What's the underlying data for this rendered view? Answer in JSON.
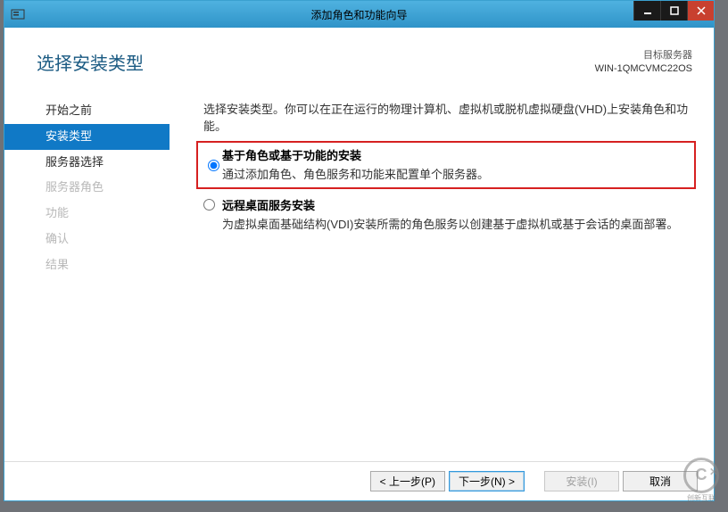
{
  "window": {
    "title": "添加角色和功能向导"
  },
  "header": {
    "page_title": "选择安装类型",
    "target_label": "目标服务器",
    "target_server": "WIN-1QMCVMC22OS"
  },
  "sidebar": {
    "steps": [
      {
        "label": "开始之前",
        "state": "enabled"
      },
      {
        "label": "安装类型",
        "state": "active"
      },
      {
        "label": "服务器选择",
        "state": "enabled"
      },
      {
        "label": "服务器角色",
        "state": "disabled"
      },
      {
        "label": "功能",
        "state": "disabled"
      },
      {
        "label": "确认",
        "state": "disabled"
      },
      {
        "label": "结果",
        "state": "disabled"
      }
    ]
  },
  "main": {
    "intro": "选择安装类型。你可以在正在运行的物理计算机、虚拟机或脱机虚拟硬盘(VHD)上安装角色和功能。",
    "options": [
      {
        "title": "基于角色或基于功能的安装",
        "desc": "通过添加角色、角色服务和功能来配置单个服务器。",
        "selected": true,
        "highlight": true
      },
      {
        "title": "远程桌面服务安装",
        "desc": "为虚拟桌面基础结构(VDI)安装所需的角色服务以创建基于虚拟机或基于会话的桌面部署。",
        "selected": false,
        "highlight": false
      }
    ]
  },
  "footer": {
    "previous": "< 上一步(P)",
    "next": "下一步(N) >",
    "install": "安装(I)",
    "cancel": "取消"
  },
  "watermark": {
    "brand": "创新互联"
  }
}
